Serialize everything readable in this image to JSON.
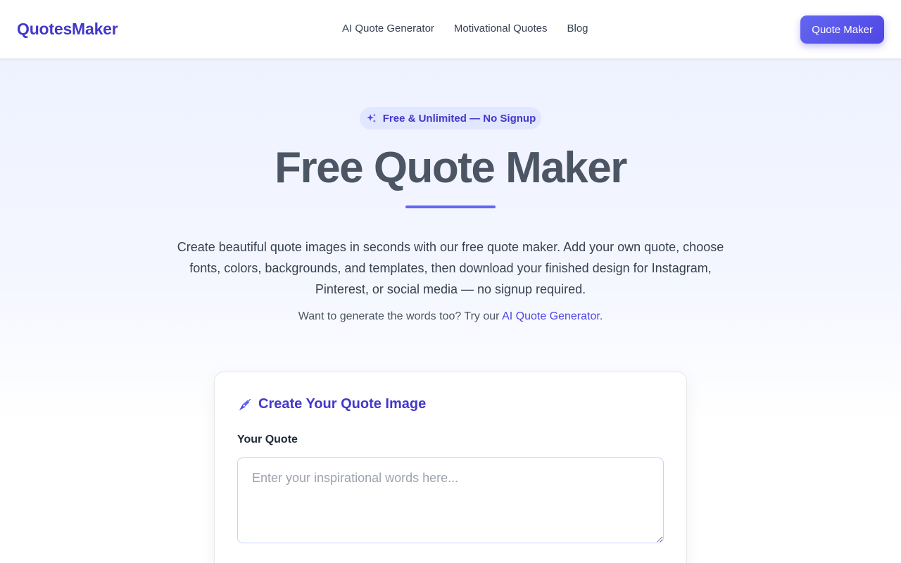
{
  "nav": {
    "logo": "QuotesMaker",
    "links": [
      "AI Quote Generator",
      "Motivational Quotes",
      "Blog"
    ],
    "cta_label": "Quote Maker"
  },
  "hero": {
    "badge_icon": "sparkles-icon",
    "badge_text": "Free & Unlimited — No Signup",
    "title": "Free Quote Maker",
    "description": "Create beautiful quote images in seconds with our free quote maker. Add your own quote, choose fonts, colors, backgrounds, and templates, then download your finished design for Instagram, Pinterest, or social media — no signup required.",
    "sub_prefix": "Want to generate the words too? Try our ",
    "sub_link": "AI Quote Generator",
    "sub_suffix": "."
  },
  "editor": {
    "title_icon": "pen-icon",
    "title": "Create Your Quote Image",
    "quote_label": "Your Quote",
    "quote_value": "",
    "quote_placeholder": "Enter your inspirational words here..."
  },
  "colors": {
    "brand": "#4338ca",
    "accent": "#6366f1",
    "hero_bg": "#eef2ff",
    "badge_bg": "#e0e7ff"
  }
}
